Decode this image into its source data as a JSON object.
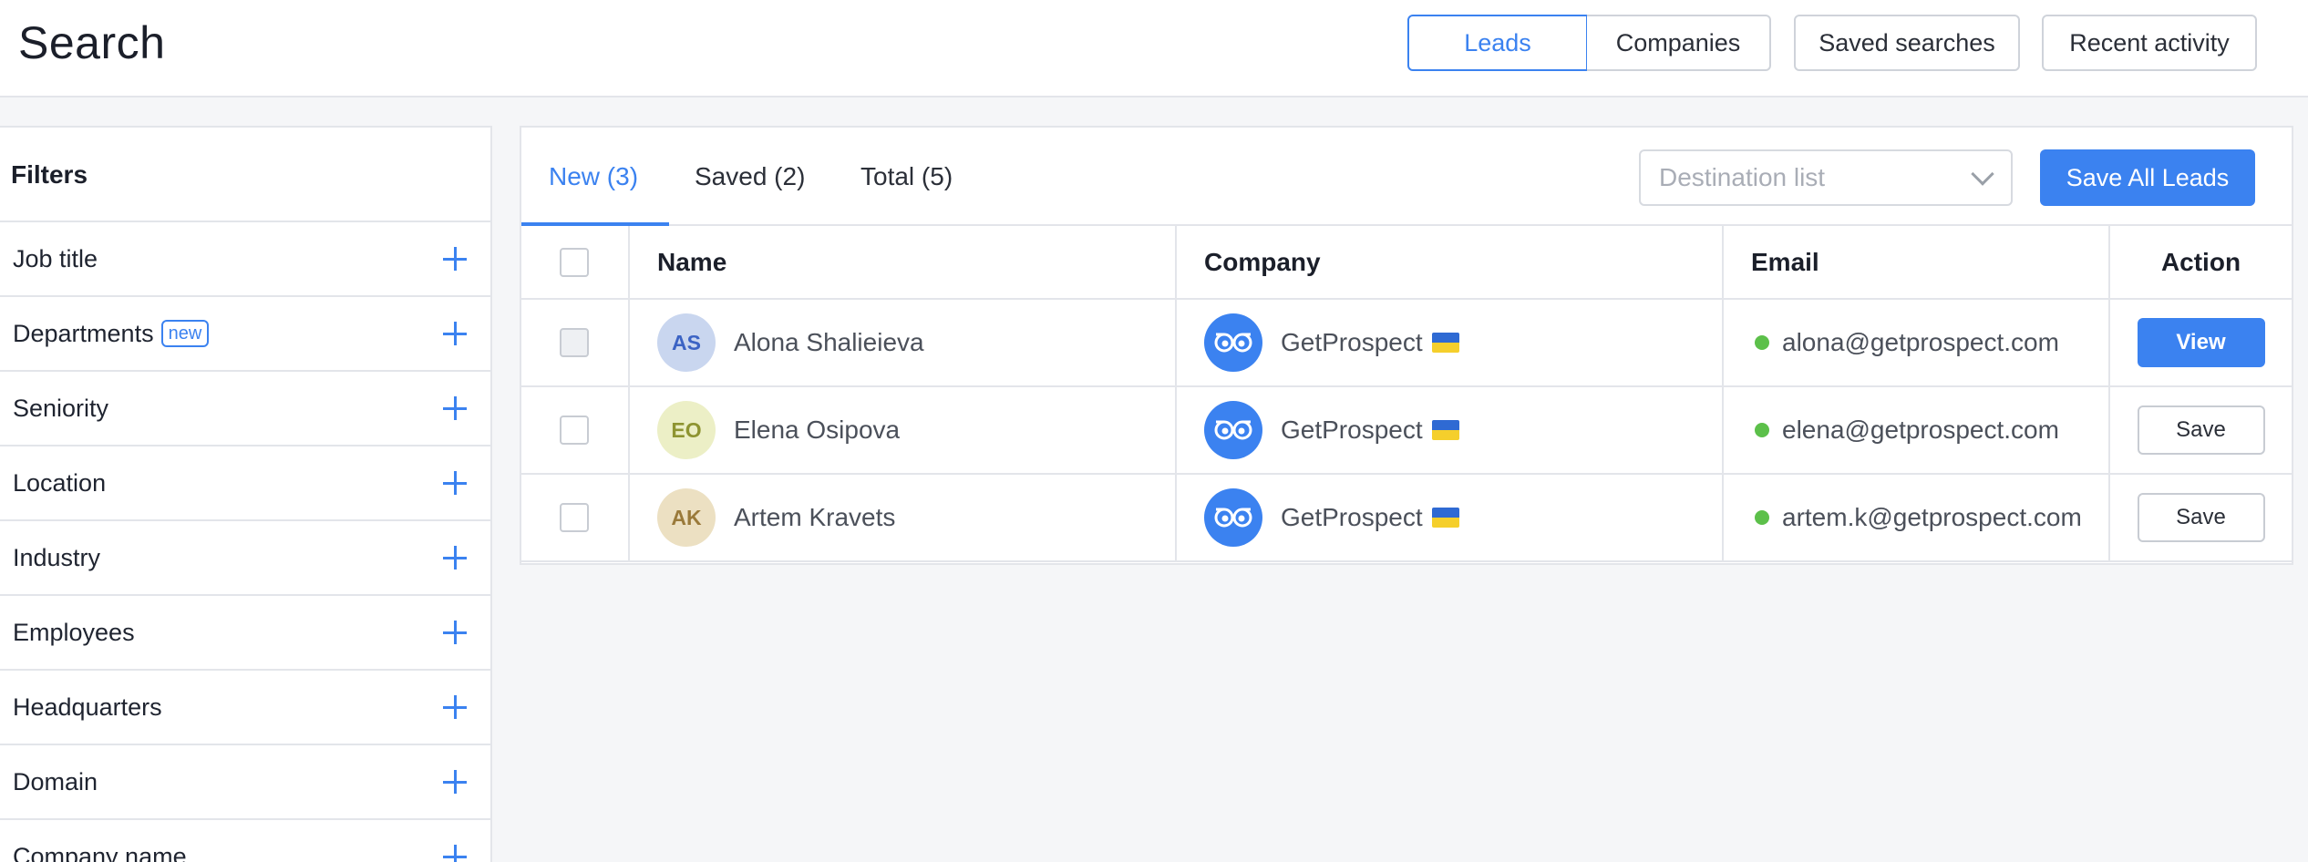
{
  "header": {
    "title": "Search",
    "mode_tabs": {
      "leads": "Leads",
      "companies": "Companies",
      "active": "leads"
    },
    "saved_searches_label": "Saved searches",
    "recent_activity_label": "Recent activity"
  },
  "sidebar": {
    "title": "Filters",
    "items": [
      {
        "label": "Job title",
        "icon": "plus-icon"
      },
      {
        "label": "Departments",
        "badge": "new",
        "icon": "plus-icon"
      },
      {
        "label": "Seniority",
        "icon": "plus-icon"
      },
      {
        "label": "Location",
        "icon": "plus-icon"
      },
      {
        "label": "Industry",
        "icon": "plus-icon"
      },
      {
        "label": "Employees",
        "icon": "plus-icon"
      },
      {
        "label": "Headquarters",
        "icon": "plus-icon"
      },
      {
        "label": "Domain",
        "icon": "plus-icon"
      },
      {
        "label": "Company name",
        "icon": "plus-icon"
      }
    ]
  },
  "results": {
    "tabs": [
      {
        "label": "New (3)",
        "active": true
      },
      {
        "label": "Saved (2)",
        "active": false
      },
      {
        "label": "Total (5)",
        "active": false
      }
    ],
    "destination_list": {
      "placeholder": "Destination list"
    },
    "save_all_label": "Save All Leads",
    "columns": {
      "name": "Name",
      "company": "Company",
      "email": "Email",
      "action": "Action"
    },
    "rows": [
      {
        "initials": "AS",
        "name": "Alona Shalieieva",
        "company": "GetProspect",
        "email": "alona@getprospect.com",
        "action": "View",
        "avatar_bg": "#c9d6ef",
        "avatar_fg": "#3b63c4",
        "checkbox_disabled": true
      },
      {
        "initials": "EO",
        "name": "Elena Osipova",
        "company": "GetProspect",
        "email": "elena@getprospect.com",
        "action": "Save",
        "avatar_bg": "#ecefc6",
        "avatar_fg": "#8e9431",
        "checkbox_disabled": false
      },
      {
        "initials": "AK",
        "name": "Artem Kravets",
        "company": "GetProspect",
        "email": "artem.k@getprospect.com",
        "action": "Save",
        "avatar_bg": "#ece0c2",
        "avatar_fg": "#9a7a3a",
        "checkbox_disabled": false
      }
    ]
  },
  "colors": {
    "accent": "#3b82f0",
    "status_ok": "#5cc04a",
    "border": "#e3e5ea"
  }
}
